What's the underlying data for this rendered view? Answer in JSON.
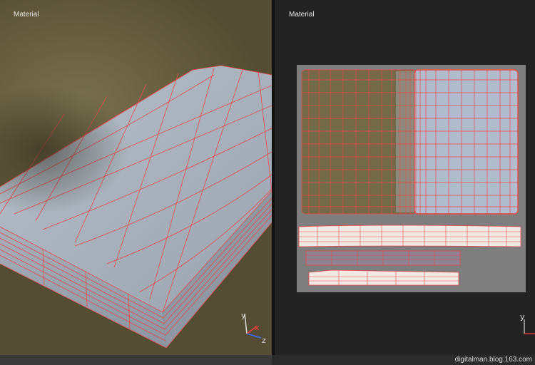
{
  "viewports": {
    "left": {
      "label": "Material"
    },
    "right": {
      "label": "Material"
    }
  },
  "gizmo_left": {
    "x": "x",
    "y": "y",
    "z": "z",
    "colors": {
      "x": "#ff3b3b",
      "y": "#dcdcdc",
      "z": "#3b6cff"
    }
  },
  "gizmo_right": {
    "y": "y"
  },
  "colors": {
    "wire": "#e84a4a",
    "mesh": "#a3adb8",
    "uv_bg": "#7e7e7e"
  },
  "watermark": "digitalman.blog.163.com"
}
